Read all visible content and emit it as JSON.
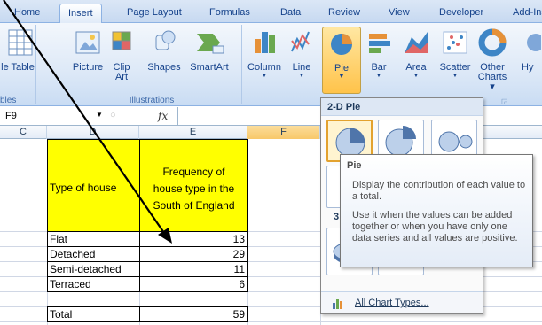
{
  "tabs": [
    "Home",
    "Insert",
    "Page Layout",
    "Formulas",
    "Data",
    "Review",
    "View",
    "Developer",
    "Add-Ins"
  ],
  "active_tab": "Insert",
  "ribbon": {
    "tables_group": {
      "label": "bles",
      "button": "le Table"
    },
    "illustrations_group": {
      "label": "Illustrations",
      "buttons": [
        {
          "label": "Picture"
        },
        {
          "label": "Clip",
          "label2": "Art"
        },
        {
          "label": "Shapes"
        },
        {
          "label": "SmartArt"
        }
      ]
    },
    "charts_group": {
      "buttons": [
        {
          "label": "Column"
        },
        {
          "label": "Line"
        },
        {
          "label": "Pie"
        },
        {
          "label": "Bar"
        },
        {
          "label": "Area"
        },
        {
          "label": "Scatter"
        },
        {
          "label": "Other",
          "label2": "Charts"
        }
      ],
      "next_label": "Hy"
    }
  },
  "formula_bar": {
    "cell_ref": "F9",
    "fx": "fx",
    "value": ""
  },
  "columns": [
    "C",
    "D",
    "E",
    "F"
  ],
  "selected_column": "F",
  "table": {
    "header_col1": "Type of house",
    "header_col2_lines": [
      "Frequency of",
      "house type in the",
      "South of England"
    ],
    "rows": [
      {
        "type": "Flat",
        "value": "13"
      },
      {
        "type": "Detached",
        "value": "29"
      },
      {
        "type": "Semi-detached",
        "value": "11"
      },
      {
        "type": "Terraced",
        "value": "6"
      },
      {
        "type": "Total",
        "value": "59"
      }
    ]
  },
  "dropdown": {
    "section_2d": "2-D Pie",
    "section_3d": "3",
    "all_chart_types": "All Chart Types..."
  },
  "tooltip": {
    "title": "Pie",
    "line1": "Display the contribution of each value to a total.",
    "line2": "Use it when the values can be added together or when you have only one data series and all values are positive."
  },
  "colors": {
    "yellow": "#ffff00",
    "ribbon_blue": "#dce8f7",
    "pie_highlight": "#ffc34a"
  }
}
